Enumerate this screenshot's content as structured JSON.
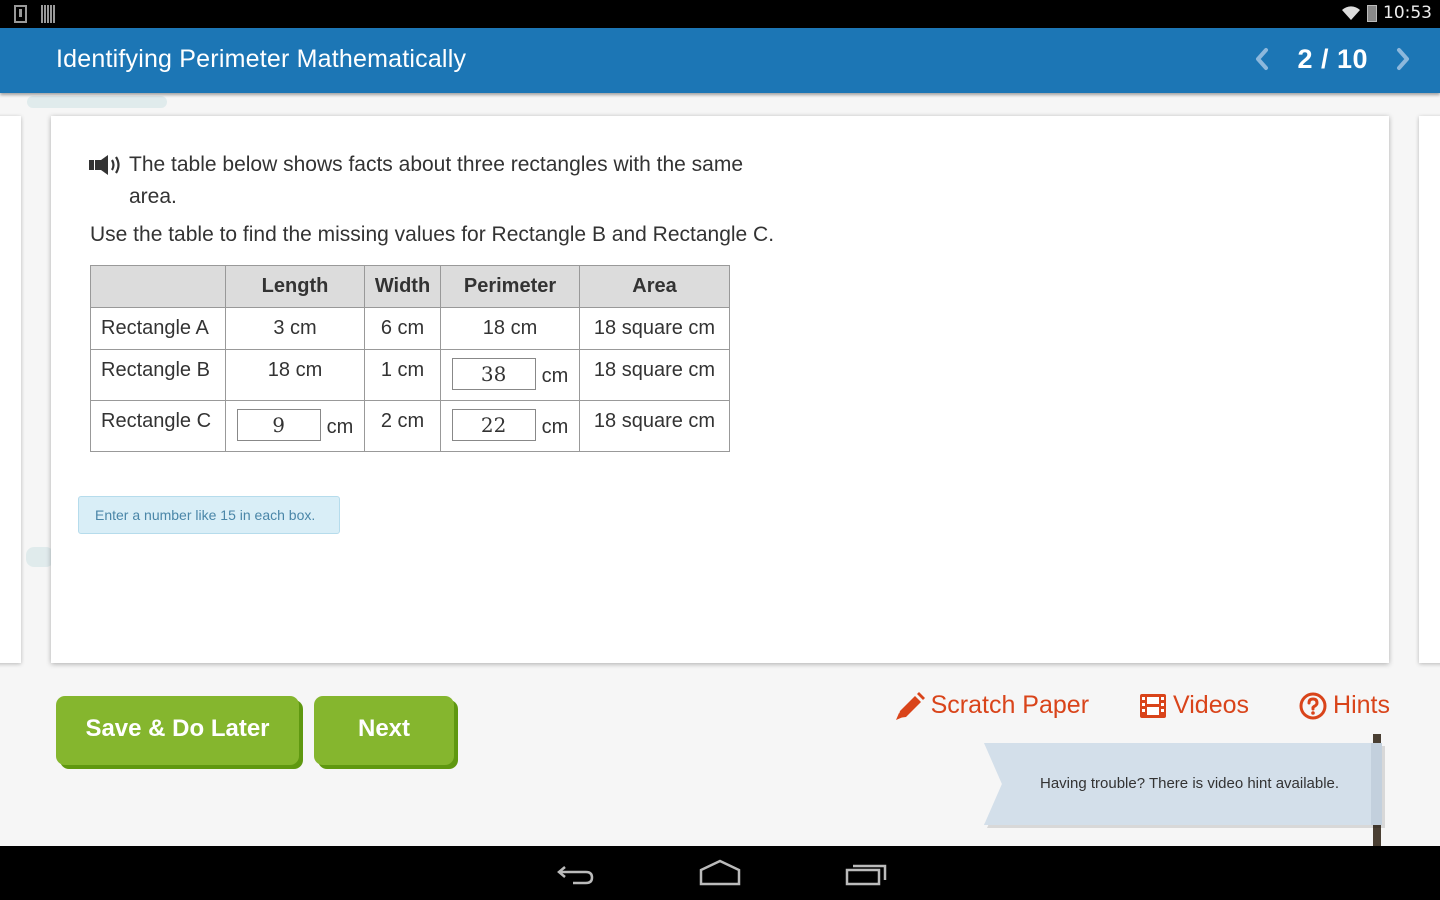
{
  "status_bar": {
    "time": "10:53",
    "icons": [
      "download-icon",
      "barcode-icon",
      "wifi-icon",
      "battery-charging-icon"
    ]
  },
  "header": {
    "title": "Identifying Perimeter Mathematically",
    "pager": {
      "current": 2,
      "total": 10,
      "label": "2 / 10",
      "prev_icon": "chevron-left-icon",
      "next_icon": "chevron-right-icon"
    }
  },
  "question": {
    "audio_icon": "speaker-icon",
    "prompt": "The table below shows facts about three rectangles with the same area.",
    "instruction": "Use the table to find the missing values for Rectangle B and Rectangle C.",
    "table": {
      "headers": [
        "",
        "Length",
        "Width",
        "Perimeter",
        "Area"
      ],
      "rows": [
        {
          "label": "Rectangle A",
          "length": "3 cm",
          "width": "6 cm",
          "perimeter": "18 cm",
          "area": "18 square cm"
        },
        {
          "label": "Rectangle B",
          "length": "18 cm",
          "width": "1 cm",
          "perimeter_input": "38",
          "perimeter_unit": "cm",
          "area": "18 square cm"
        },
        {
          "label": "Rectangle C",
          "length_input": "9",
          "length_unit": "cm",
          "width": "2 cm",
          "perimeter_input": "22",
          "perimeter_unit": "cm",
          "area": "18 square cm"
        }
      ]
    },
    "input_hint": "Enter a number like 15 in each box."
  },
  "actions": {
    "save_label": "Save & Do Later",
    "next_label": "Next",
    "button_color": "#85b62e"
  },
  "tools": {
    "accent_color": "#d9441a",
    "items": [
      {
        "label": "Scratch Paper",
        "icon": "pencil-icon"
      },
      {
        "label": "Videos",
        "icon": "film-icon"
      },
      {
        "label": "Hints",
        "icon": "question-circle-icon"
      }
    ]
  },
  "banner": {
    "text": "Having trouble? There is video hint available."
  },
  "nav_bar": {
    "buttons": [
      "back-icon",
      "home-icon",
      "recent-apps-icon"
    ]
  }
}
